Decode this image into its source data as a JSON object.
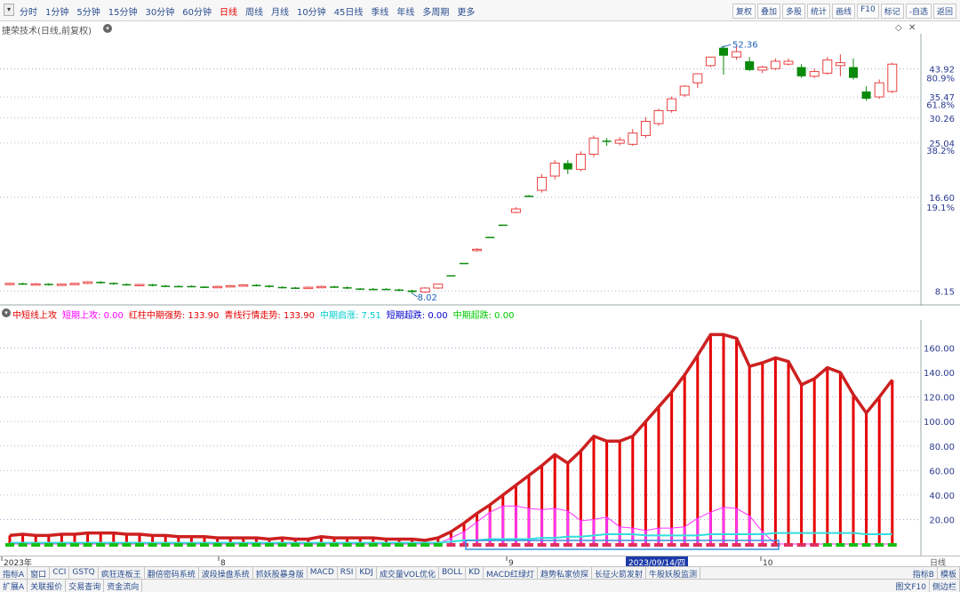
{
  "menu_icon": "dropdown-caret-icon",
  "period_tabs": [
    "分时",
    "1分钟",
    "5分钟",
    "15分钟",
    "30分钟",
    "60分钟",
    "日线",
    "周线",
    "月线",
    "10分钟",
    "45日线",
    "季线",
    "年线",
    "多周期",
    "更多"
  ],
  "active_period": "日线",
  "right_tools": [
    "复权",
    "叠加",
    "多股",
    "统计",
    "画线",
    "F10",
    "标记",
    "-自选",
    "返回"
  ],
  "stock_title": "捷荣技术(日线,前复权)",
  "main_chart": {
    "price_labels": [
      "43.92",
      "35.47",
      "30.26",
      "25.04",
      "16.60",
      "8.15"
    ],
    "pct_labels": [
      "80.9%",
      "61.8%",
      "38.2%",
      "19.1%"
    ],
    "high_marker": "52.36",
    "low_marker": "8.02",
    "candles": [
      {
        "o": 8.6,
        "c": 8.65,
        "h": 8.7,
        "l": 8.55,
        "d": "up"
      },
      {
        "o": 8.65,
        "c": 8.6,
        "h": 8.7,
        "l": 8.55,
        "d": "down"
      },
      {
        "o": 8.6,
        "c": 8.62,
        "h": 8.68,
        "l": 8.55,
        "d": "up"
      },
      {
        "o": 8.62,
        "c": 8.58,
        "h": 8.66,
        "l": 8.5,
        "d": "down"
      },
      {
        "o": 8.58,
        "c": 8.6,
        "h": 8.65,
        "l": 8.55,
        "d": "up"
      },
      {
        "o": 8.6,
        "c": 8.65,
        "h": 8.7,
        "l": 8.55,
        "d": "up"
      },
      {
        "o": 8.65,
        "c": 8.75,
        "h": 8.8,
        "l": 8.6,
        "d": "up"
      },
      {
        "o": 8.75,
        "c": 8.68,
        "h": 8.8,
        "l": 8.62,
        "d": "down"
      },
      {
        "o": 8.68,
        "c": 8.6,
        "h": 8.72,
        "l": 8.55,
        "d": "down"
      },
      {
        "o": 8.6,
        "c": 8.55,
        "h": 8.65,
        "l": 8.5,
        "d": "down"
      },
      {
        "o": 8.55,
        "c": 8.58,
        "h": 8.62,
        "l": 8.5,
        "d": "up"
      },
      {
        "o": 8.58,
        "c": 8.5,
        "h": 8.62,
        "l": 8.45,
        "d": "down"
      },
      {
        "o": 8.5,
        "c": 8.45,
        "h": 8.55,
        "l": 8.4,
        "d": "down"
      },
      {
        "o": 8.45,
        "c": 8.48,
        "h": 8.52,
        "l": 8.42,
        "d": "flat"
      },
      {
        "o": 8.48,
        "c": 8.44,
        "h": 8.52,
        "l": 8.4,
        "d": "down"
      },
      {
        "o": 8.44,
        "c": 8.4,
        "h": 8.48,
        "l": 8.36,
        "d": "down"
      },
      {
        "o": 8.4,
        "c": 8.45,
        "h": 8.5,
        "l": 8.35,
        "d": "up"
      },
      {
        "o": 8.45,
        "c": 8.5,
        "h": 8.55,
        "l": 8.4,
        "d": "up"
      },
      {
        "o": 8.5,
        "c": 8.55,
        "h": 8.6,
        "l": 8.45,
        "d": "up"
      },
      {
        "o": 8.55,
        "c": 8.5,
        "h": 8.6,
        "l": 8.45,
        "d": "down"
      },
      {
        "o": 8.5,
        "c": 8.42,
        "h": 8.55,
        "l": 8.38,
        "d": "down"
      },
      {
        "o": 8.42,
        "c": 8.38,
        "h": 8.46,
        "l": 8.32,
        "d": "down"
      },
      {
        "o": 8.38,
        "c": 8.35,
        "h": 8.42,
        "l": 8.3,
        "d": "down"
      },
      {
        "o": 8.35,
        "c": 8.4,
        "h": 8.45,
        "l": 8.3,
        "d": "up"
      },
      {
        "o": 8.4,
        "c": 8.45,
        "h": 8.5,
        "l": 8.35,
        "d": "up"
      },
      {
        "o": 8.45,
        "c": 8.4,
        "h": 8.5,
        "l": 8.35,
        "d": "down"
      },
      {
        "o": 8.4,
        "c": 8.32,
        "h": 8.45,
        "l": 8.28,
        "d": "down"
      },
      {
        "o": 8.32,
        "c": 8.28,
        "h": 8.36,
        "l": 8.24,
        "d": "down"
      },
      {
        "o": 8.28,
        "c": 8.3,
        "h": 8.35,
        "l": 8.25,
        "d": "flat"
      },
      {
        "o": 8.3,
        "c": 8.26,
        "h": 8.34,
        "l": 8.22,
        "d": "down"
      },
      {
        "o": 8.26,
        "c": 8.2,
        "h": 8.3,
        "l": 8.15,
        "d": "down"
      },
      {
        "o": 8.2,
        "c": 8.1,
        "h": 8.24,
        "l": 8.02,
        "d": "down"
      },
      {
        "o": 8.1,
        "c": 8.35,
        "h": 8.4,
        "l": 8.05,
        "d": "up"
      },
      {
        "o": 8.35,
        "c": 8.6,
        "h": 8.62,
        "l": 8.3,
        "d": "up"
      },
      {
        "o": 9.2,
        "c": 9.2,
        "h": 9.2,
        "l": 9.2,
        "d": "flat"
      },
      {
        "o": 10.1,
        "c": 10.1,
        "h": 10.1,
        "l": 10.1,
        "d": "flat"
      },
      {
        "o": 11.1,
        "c": 11.2,
        "h": 11.3,
        "l": 11.0,
        "d": "up"
      },
      {
        "o": 12.3,
        "c": 12.3,
        "h": 12.3,
        "l": 12.3,
        "d": "flat"
      },
      {
        "o": 13.5,
        "c": 13.5,
        "h": 13.5,
        "l": 13.5,
        "d": "flat"
      },
      {
        "o": 14.8,
        "c": 15.2,
        "h": 15.4,
        "l": 14.7,
        "d": "up"
      },
      {
        "o": 16.8,
        "c": 16.8,
        "h": 16.9,
        "l": 16.7,
        "d": "flat"
      },
      {
        "o": 17.5,
        "c": 19.3,
        "h": 19.8,
        "l": 17.2,
        "d": "up"
      },
      {
        "o": 19.5,
        "c": 21.5,
        "h": 22.0,
        "l": 19.0,
        "d": "up"
      },
      {
        "o": 21.5,
        "c": 20.5,
        "h": 22.0,
        "l": 19.8,
        "d": "down"
      },
      {
        "o": 20.5,
        "c": 23.0,
        "h": 23.5,
        "l": 20.2,
        "d": "up"
      },
      {
        "o": 23.0,
        "c": 26.0,
        "h": 26.5,
        "l": 22.5,
        "d": "up"
      },
      {
        "o": 25.5,
        "c": 25.3,
        "h": 26.0,
        "l": 24.5,
        "d": "down"
      },
      {
        "o": 25.0,
        "c": 25.6,
        "h": 26.2,
        "l": 24.6,
        "d": "up"
      },
      {
        "o": 24.8,
        "c": 27.0,
        "h": 27.8,
        "l": 24.5,
        "d": "up"
      },
      {
        "o": 26.5,
        "c": 29.5,
        "h": 30.5,
        "l": 26.0,
        "d": "up"
      },
      {
        "o": 29.0,
        "c": 32.0,
        "h": 32.5,
        "l": 28.5,
        "d": "up"
      },
      {
        "o": 32.0,
        "c": 35.0,
        "h": 35.6,
        "l": 31.5,
        "d": "up"
      },
      {
        "o": 36.0,
        "c": 38.5,
        "h": 38.8,
        "l": 35.5,
        "d": "up"
      },
      {
        "o": 39.5,
        "c": 42.3,
        "h": 42.5,
        "l": 38.0,
        "d": "up"
      },
      {
        "o": 45.0,
        "c": 48.0,
        "h": 48.2,
        "l": 44.5,
        "d": "up"
      },
      {
        "o": 51.5,
        "c": 48.5,
        "h": 52.36,
        "l": 42.0,
        "d": "down"
      },
      {
        "o": 48.0,
        "c": 50.0,
        "h": 52.0,
        "l": 47.0,
        "d": "up"
      },
      {
        "o": 46.5,
        "c": 43.5,
        "h": 48.0,
        "l": 43.2,
        "d": "down"
      },
      {
        "o": 43.5,
        "c": 44.5,
        "h": 45.0,
        "l": 42.5,
        "d": "up"
      },
      {
        "o": 44.0,
        "c": 46.5,
        "h": 47.5,
        "l": 43.5,
        "d": "up"
      },
      {
        "o": 45.5,
        "c": 46.5,
        "h": 47.5,
        "l": 45.0,
        "d": "up"
      },
      {
        "o": 44.5,
        "c": 41.5,
        "h": 45.5,
        "l": 41.0,
        "d": "down"
      },
      {
        "o": 41.5,
        "c": 43.0,
        "h": 44.0,
        "l": 41.0,
        "d": "up"
      },
      {
        "o": 42.5,
        "c": 47.0,
        "h": 48.0,
        "l": 42.0,
        "d": "up"
      },
      {
        "o": 45.0,
        "c": 46.0,
        "h": 49.0,
        "l": 41.5,
        "d": "up"
      },
      {
        "o": 44.5,
        "c": 41.0,
        "h": 47.5,
        "l": 40.5,
        "d": "down"
      },
      {
        "o": 37.0,
        "c": 35.0,
        "h": 38.5,
        "l": 34.5,
        "d": "down"
      },
      {
        "o": 35.5,
        "c": 39.5,
        "h": 40.5,
        "l": 35.0,
        "d": "up"
      },
      {
        "o": 37.0,
        "c": 45.5,
        "h": 46.0,
        "l": 36.5,
        "d": "up"
      }
    ]
  },
  "indicator": {
    "items": [
      {
        "label": "中短线上攻",
        "value": "",
        "color": "#e60000"
      },
      {
        "label": "短期上攻: ",
        "value": "0.00",
        "color": "#ff00ff"
      },
      {
        "label": "红柱中期强势: ",
        "value": "133.90",
        "color": "#e60000"
      },
      {
        "label": "青线行情走势: ",
        "value": "133.90",
        "color": "#e60000"
      },
      {
        "label": "中期启涨: ",
        "value": "7.51",
        "color": "#00cccc"
      },
      {
        "label": "短期超跌: ",
        "value": "0.00",
        "color": "#0000cc"
      },
      {
        "label": "中期超跌: ",
        "value": "0.00",
        "color": "#00cc00"
      }
    ],
    "y_labels": [
      "160.00",
      "140.00",
      "120.00",
      "100.00",
      "80.00",
      "60.00",
      "40.00",
      "20.00"
    ],
    "red_values": [
      7,
      8,
      7,
      7,
      8,
      8,
      9,
      9,
      9,
      8,
      8,
      7,
      7,
      6,
      6,
      6,
      5,
      5,
      5,
      5,
      4,
      5,
      4,
      4,
      6,
      5,
      5,
      5,
      5,
      4,
      4,
      4,
      3,
      5,
      10,
      17,
      25,
      32,
      40,
      48,
      56,
      64,
      73,
      66,
      76,
      88,
      84,
      84,
      88,
      100,
      112,
      124,
      138,
      154,
      171,
      171,
      168,
      145,
      148,
      152,
      149,
      130,
      135,
      144,
      140,
      122,
      107,
      120,
      134
    ],
    "magenta_values": [
      0,
      0,
      0,
      0,
      0,
      0,
      0,
      0,
      0,
      0,
      0,
      0,
      0,
      0,
      0,
      0,
      0,
      0,
      0,
      0,
      0,
      0,
      0,
      0,
      0,
      0,
      0,
      0,
      0,
      0,
      0,
      0,
      0,
      0,
      5,
      10,
      18,
      26,
      31,
      31,
      29,
      28,
      29,
      27,
      19,
      20,
      22,
      14,
      13,
      11,
      13,
      13,
      14,
      21,
      26,
      30,
      29,
      23,
      10,
      0,
      0,
      0,
      0,
      0,
      0,
      0,
      0,
      0,
      0
    ],
    "cyan_values": [
      1,
      1,
      1,
      1,
      1,
      1,
      1,
      1,
      1,
      1,
      1,
      1,
      1,
      1,
      1,
      1,
      1,
      1,
      1,
      1,
      1,
      1,
      1,
      1,
      1,
      1,
      1,
      1,
      1,
      1,
      1,
      1,
      1,
      1,
      2,
      3,
      3,
      4,
      4,
      4,
      4,
      5,
      5,
      6,
      6,
      7,
      8,
      8,
      8,
      7,
      7,
      7,
      7,
      7,
      8,
      8,
      8,
      8,
      8,
      9,
      9,
      9,
      9,
      9,
      9,
      9,
      8,
      8,
      8
    ],
    "ymax": 180
  },
  "date_axis": {
    "labels": [
      "2023年",
      "8",
      "9",
      "10"
    ],
    "selected_date": "2023/09/14/四",
    "right_label": "日线"
  },
  "bottom_tabs_row1": [
    "指标A",
    "窗口",
    "CCI",
    "GSTQ",
    "疯狂连板王",
    "翻倍密码系统",
    "波段操盘系统",
    "抓妖股暴身版",
    "MACD",
    "RSI",
    "KDJ",
    "成交量VOL优化",
    "BOLL",
    "KD",
    "MACD红绿灯",
    "趋势私家侦探",
    "长征火箭发射",
    "牛股妖股监测",
    "指标B",
    "模板"
  ],
  "bottom_tabs_row2": [
    "扩展A",
    "关联报价",
    "交易查询",
    "资金流向",
    "图文F10",
    "侧边栏"
  ],
  "colors": {
    "up": "#e84040",
    "down": "#0a8a0a",
    "grid": "#9aa6c8",
    "bar_red": "#e60000",
    "magenta": "#ff33ff",
    "cyan": "#33dddd",
    "axis_text": "#2a3a8f"
  }
}
